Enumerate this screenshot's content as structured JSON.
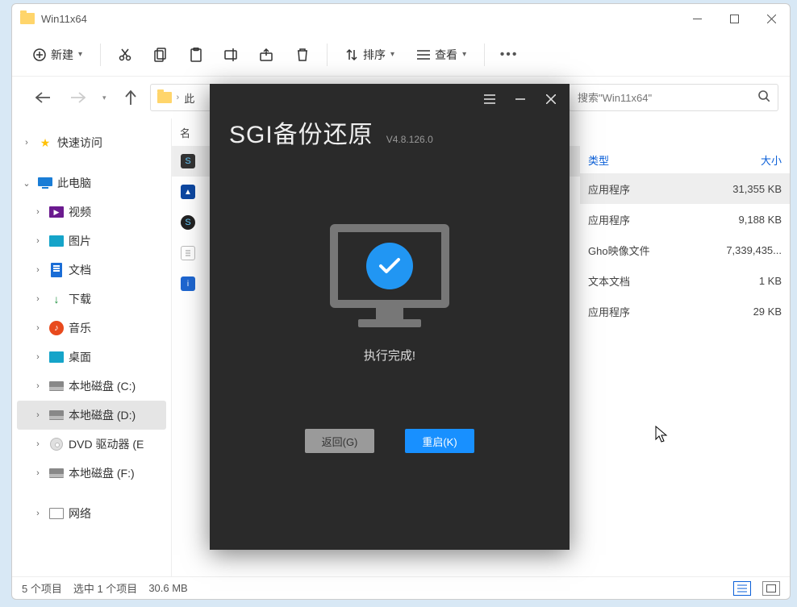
{
  "window_title": "Win11x64",
  "toolbar": {
    "new_label": "新建",
    "sort_label": "排序",
    "view_label": "查看"
  },
  "address": {
    "crumb1": "此"
  },
  "search": {
    "placeholder": "搜索\"Win11x64\""
  },
  "sidebar": {
    "quick": "快速访问",
    "pc": "此电脑",
    "video": "视频",
    "pictures": "图片",
    "docs": "文档",
    "downloads": "下载",
    "music": "音乐",
    "desktop": "桌面",
    "diskc": "本地磁盘 (C:)",
    "diskd": "本地磁盘 (D:)",
    "dvd": "DVD 驱动器 (E",
    "diskf": "本地磁盘 (F:)",
    "network": "网络"
  },
  "columns": {
    "name": "名",
    "type": "类型",
    "size": "大小"
  },
  "files": [
    {
      "type": "应用程序",
      "size": "31,355 KB",
      "selected": true
    },
    {
      "type": "应用程序",
      "size": "9,188 KB"
    },
    {
      "type": "Gho映像文件",
      "size": "7,339,435..."
    },
    {
      "type": "文本文档",
      "size": "1 KB"
    },
    {
      "type": "应用程序",
      "size": "29 KB"
    }
  ],
  "status": {
    "count": "5 个项目",
    "selected": "选中 1 个项目",
    "size": "30.6 MB"
  },
  "dialog": {
    "title": "SGI备份还原",
    "version": "V4.8.126.0",
    "message": "执行完成!",
    "back_label": "返回(G)",
    "restart_label": "重启(K)"
  }
}
